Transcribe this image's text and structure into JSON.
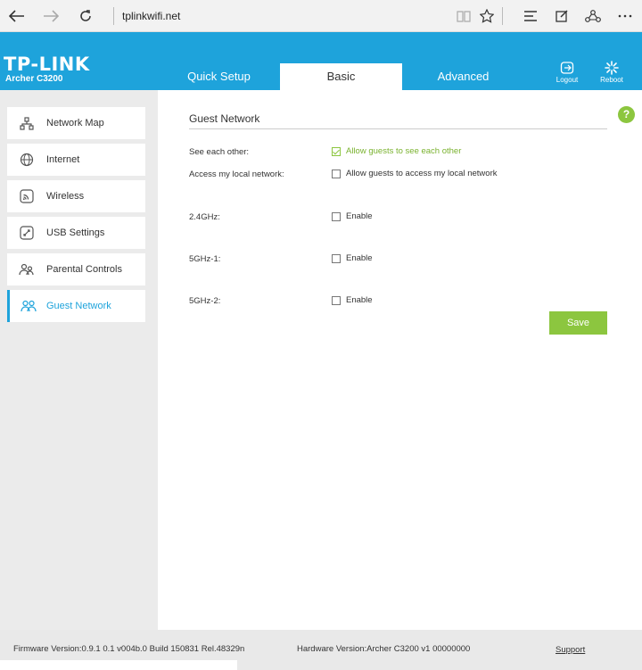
{
  "browser": {
    "url": "tplinkwifi.net",
    "icons": [
      "back-arrow-icon",
      "forward-arrow-icon",
      "refresh-icon",
      "reading-view-icon",
      "favorite-star-icon",
      "hub-icon",
      "web-note-icon",
      "share-icon",
      "more-icon"
    ]
  },
  "header": {
    "logo": "TP-LINK",
    "model": "Archer C3200",
    "tabs": [
      {
        "label": "Quick Setup"
      },
      {
        "label": "Basic"
      },
      {
        "label": "Advanced"
      }
    ],
    "actions": [
      {
        "label": "Logout",
        "icon": "logout-icon"
      },
      {
        "label": "Reboot",
        "icon": "reboot-icon"
      }
    ],
    "accent": "#1ea3db"
  },
  "sidebar": {
    "items": [
      {
        "label": "Network Map",
        "icon": "network-map-icon"
      },
      {
        "label": "Internet",
        "icon": "globe-icon"
      },
      {
        "label": "Wireless",
        "icon": "wireless-icon"
      },
      {
        "label": "USB Settings",
        "icon": "usb-icon"
      },
      {
        "label": "Parental Controls",
        "icon": "parental-controls-icon"
      },
      {
        "label": "Guest Network",
        "icon": "guest-network-icon",
        "active": true
      }
    ]
  },
  "main": {
    "title": "Guest Network",
    "help": "?",
    "rows": [
      {
        "label": "See each other:",
        "option": "Allow guests to see each other",
        "checked": true
      },
      {
        "label": "Access my local network:",
        "option": "Allow guests to access my local network",
        "checked": false
      },
      {
        "label": "2.4GHz:",
        "option": "Enable",
        "checked": false
      },
      {
        "label": "5GHz-1:",
        "option": "Enable",
        "checked": false
      },
      {
        "label": "5GHz-2:",
        "option": "Enable",
        "checked": false
      }
    ],
    "save_label": "Save",
    "save_color": "#8cc63f"
  },
  "footer": {
    "firmware": "Firmware Version:0.9.1 0.1 v004b.0 Build 150831 Rel.48329n",
    "hardware": "Hardware Version:Archer C3200 v1 00000000",
    "support": "Support"
  }
}
